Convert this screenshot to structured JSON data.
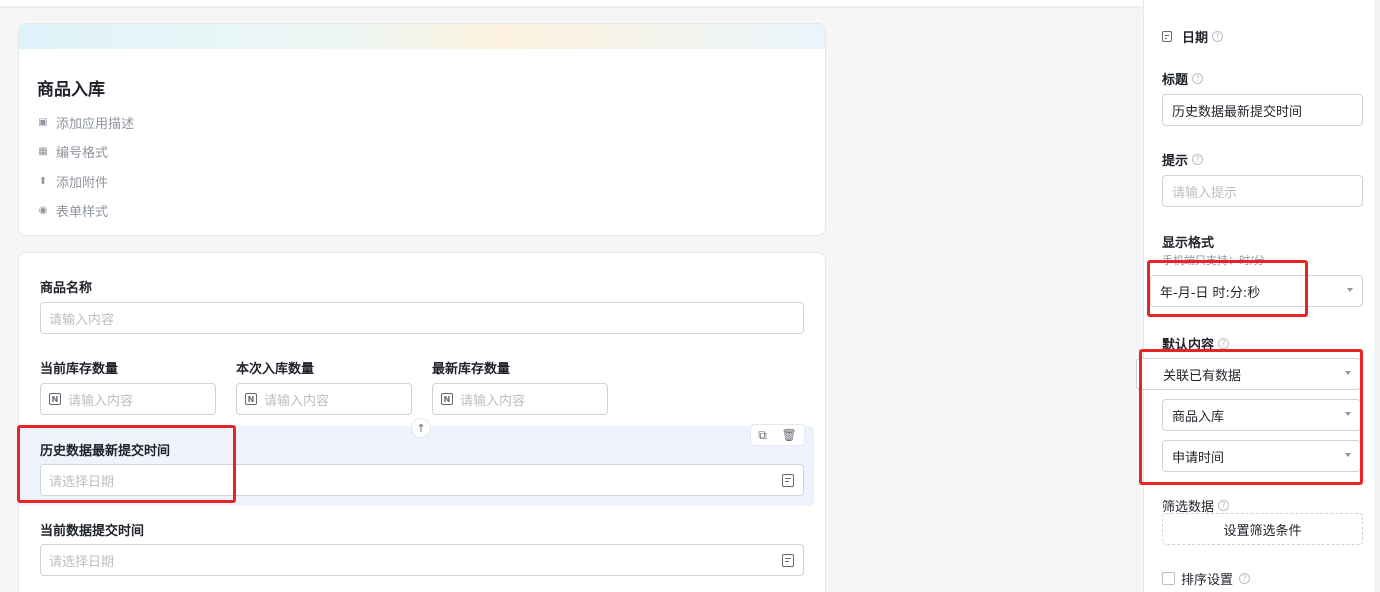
{
  "header": {
    "app_title": "商品入库",
    "items": [
      {
        "icon": "comment-icon",
        "label": "添加应用描述"
      },
      {
        "icon": "number-icon",
        "label": "编号格式"
      },
      {
        "icon": "upload-icon",
        "label": "添加附件"
      },
      {
        "icon": "palette-icon",
        "label": "表单样式"
      }
    ]
  },
  "form": {
    "product_name": {
      "label": "商品名称",
      "placeholder": "请输入内容"
    },
    "current_stock": {
      "label": "当前库存数量",
      "placeholder": "请输入内容"
    },
    "this_inbound": {
      "label": "本次入库数量",
      "placeholder": "请输入内容"
    },
    "latest_stock": {
      "label": "最新库存数量",
      "placeholder": "请输入内容"
    },
    "history_submit_time": {
      "label": "历史数据最新提交时间",
      "placeholder": "请选择日期"
    },
    "current_submit_time": {
      "label": "当前数据提交时间",
      "placeholder": "请选择日期"
    }
  },
  "side": {
    "field_type": "日期",
    "title_label": "标题",
    "title_value": "历史数据最新提交时间",
    "hint_label": "提示",
    "hint_placeholder": "请输入提示",
    "format_label": "显示格式",
    "format_hint": "手机端只支持：时/分",
    "format_value": "年-月-日 时:分:秒",
    "default_label": "默认内容",
    "default_source": "关联已有数据",
    "default_form": "商品入库",
    "default_field": "申请时间",
    "filter_label": "筛选数据",
    "filter_button": "设置筛选条件",
    "sort_label": "排序设置"
  },
  "colors": {
    "accent_bg": "#eff3fd",
    "highlight_red": "#e82424"
  }
}
